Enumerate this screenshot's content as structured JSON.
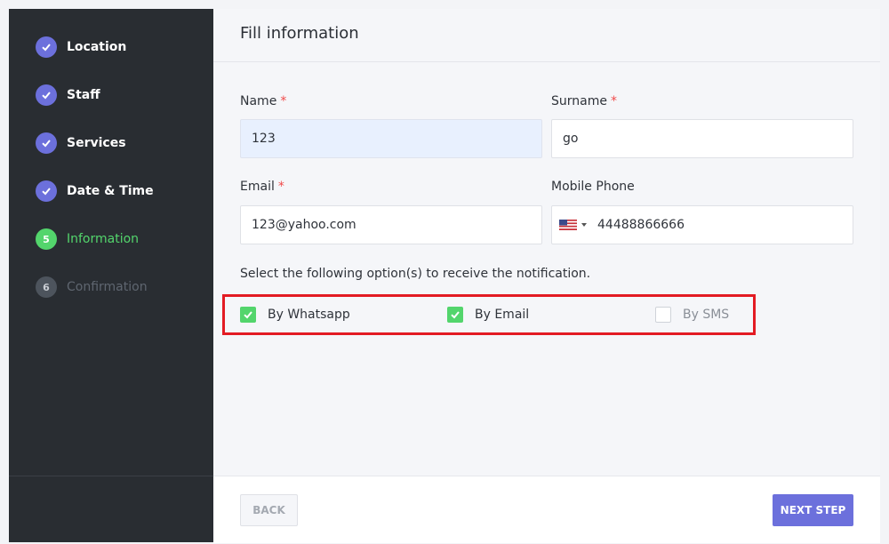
{
  "sidebar": {
    "steps": [
      {
        "label": "Location",
        "status": "done",
        "marker": ""
      },
      {
        "label": "Staff",
        "status": "done",
        "marker": ""
      },
      {
        "label": "Services",
        "status": "done",
        "marker": ""
      },
      {
        "label": "Date & Time",
        "status": "done",
        "marker": ""
      },
      {
        "label": "Information",
        "status": "active",
        "marker": "5"
      },
      {
        "label": "Confirmation",
        "status": "todo",
        "marker": "6"
      }
    ]
  },
  "form": {
    "title": "Fill information",
    "required_mark": "*",
    "name_label": "Name",
    "name_value": "123",
    "surname_label": "Surname",
    "surname_value": "go",
    "email_label": "Email",
    "email_value": "123@yahoo.com",
    "phone_label": "Mobile Phone",
    "phone_value": "44488866666",
    "phone_country_icon": "us-flag-icon",
    "notification_text": "Select the following option(s) to receive the notification.",
    "options": [
      {
        "label": "By Whatsapp",
        "checked": true
      },
      {
        "label": "By Email",
        "checked": true
      },
      {
        "label": "By SMS",
        "checked": false
      }
    ]
  },
  "footer": {
    "back_label": "BACK",
    "next_label": "NEXT STEP"
  },
  "colors": {
    "accent": "#6c70dc",
    "success": "#53d56c",
    "sidebar_bg": "#292d32",
    "highlight": "#e31b23"
  }
}
